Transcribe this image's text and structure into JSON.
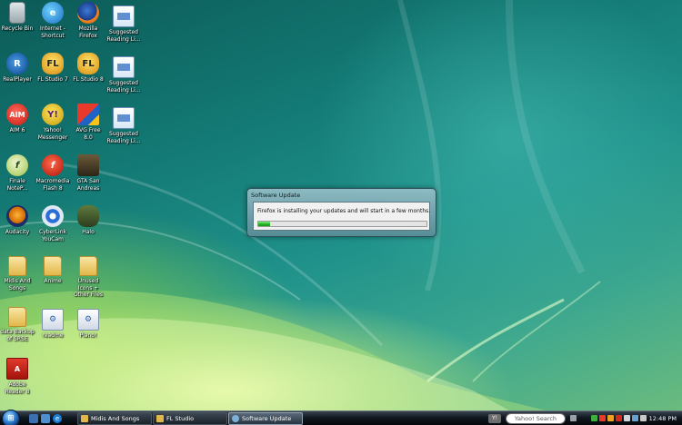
{
  "desktop": {
    "icons": [
      {
        "label": "Recycle Bin",
        "icon": "recycle-bin-icon"
      },
      {
        "label": "Internet - Shortcut",
        "icon": "internet-explorer-icon"
      },
      {
        "label": "Mozilla Firefox",
        "icon": "firefox-icon"
      },
      {
        "label": "Suggested Reading Li...",
        "icon": "document-icon"
      },
      {
        "label": "RealPlayer",
        "icon": "realplayer-icon"
      },
      {
        "label": "FL Studio 7",
        "icon": "fl-studio-icon"
      },
      {
        "label": "FL Studio 8",
        "icon": "fl-studio-icon"
      },
      {
        "label": "Suggested Reading Li...",
        "icon": "document-icon"
      },
      {
        "label": "AIM 6",
        "icon": "aim-icon"
      },
      {
        "label": "Yahoo! Messenger",
        "icon": "yahoo-messenger-icon"
      },
      {
        "label": "AVG Free 8.0",
        "icon": "avg-icon"
      },
      {
        "label": "Suggested Reading Li...",
        "icon": "document-icon"
      },
      {
        "label": "Finale NoteP...",
        "icon": "finale-icon"
      },
      {
        "label": "Macromedia Flash 8",
        "icon": "flash-icon"
      },
      {
        "label": "GTA San Andreas",
        "icon": "gta-icon"
      },
      {
        "label": "Audacity",
        "icon": "audacity-icon"
      },
      {
        "label": "CyberLink YouCam",
        "icon": "youcam-icon"
      },
      {
        "label": "Halo",
        "icon": "halo-icon"
      },
      {
        "label": "Midis And Songs",
        "icon": "folder-icon"
      },
      {
        "label": "Anime",
        "icon": "folder-icon"
      },
      {
        "label": "Unused Icons + Other Files",
        "icon": "folder-icon"
      },
      {
        "label": "data Backup of SRSE",
        "icon": "folder-icon"
      },
      {
        "label": "readme",
        "icon": "installer-icon"
      },
      {
        "label": "Piano!",
        "icon": "installer-icon"
      },
      {
        "label": "Adobe Reader 8",
        "icon": "adobe-reader-icon"
      }
    ]
  },
  "dialog": {
    "title": "Software Update",
    "message": "Firefox is installing your updates and will start in a few months.",
    "progress_fraction": 0.07
  },
  "taskbar": {
    "start_glyph": "⊞",
    "quick_launch": [
      "show-desktop-icon",
      "switch-windows-icon",
      "internet-explorer-icon"
    ],
    "buttons": [
      {
        "label": "Midis And Songs",
        "icon": "folder-icon"
      },
      {
        "label": "FL Studio",
        "icon": "folder-icon"
      },
      {
        "label": "Software Update",
        "icon": "update-icon"
      }
    ],
    "yahoo_logo": "Y!",
    "search_placeholder": "Yahoo! Search",
    "clock": "12:48 PM"
  },
  "colors": {
    "progress_green": "#22b022",
    "taskbar_dark": "#111820",
    "wallpaper_teal": "#137873"
  }
}
